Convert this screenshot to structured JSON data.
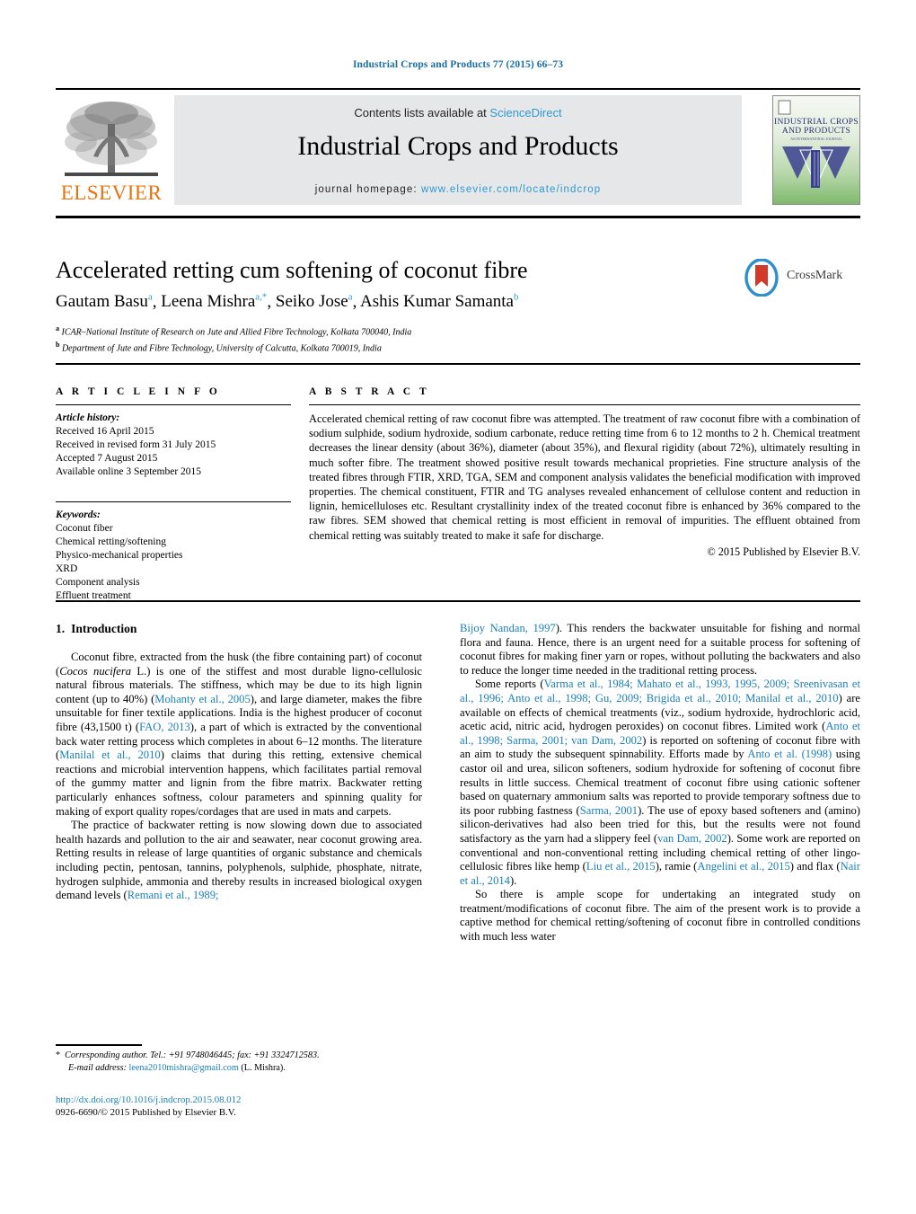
{
  "running_head": "Industrial Crops and Products 77 (2015) 66–73",
  "masthead": {
    "contents_prefix": "Contents lists available at ",
    "sciencedirect": "ScienceDirect",
    "journal_title": "Industrial Crops and Products",
    "homepage_prefix": "journal homepage: ",
    "homepage_url": "www.elsevier.com/locate/indcrop",
    "elsevier_wordmark": "ELSEVIER",
    "cover_title_line1": "INDUSTRIAL CROPS",
    "cover_title_line2": "AND PRODUCTS",
    "accent_color": "#2e9ad0",
    "elsevier_orange": "#E8730E"
  },
  "title_block": {
    "title": "Accelerated retting cum softening of coconut fibre",
    "authors": [
      {
        "name": "Gautam Basu",
        "marks": "a"
      },
      {
        "name": "Leena Mishra",
        "marks": "a,*"
      },
      {
        "name": "Seiko Jose",
        "marks": "a"
      },
      {
        "name": "Ashis Kumar Samanta",
        "marks": "b"
      }
    ],
    "affiliations": [
      {
        "mark": "a",
        "text": "ICAR–National Institute of Research on Jute and Allied Fibre Technology, Kolkata 700040, India"
      },
      {
        "mark": "b",
        "text": "Department of Jute and Fibre Technology, University of Calcutta, Kolkata 700019, India"
      }
    ],
    "crossmark_label": "CrossMark"
  },
  "article_info": {
    "heading": "A R T I C L E   I N F O",
    "history_label": "Article history:",
    "history": [
      "Received 16 April 2015",
      "Received in revised form 31 July 2015",
      "Accepted 7 August 2015",
      "Available online 3 September 2015"
    ],
    "keywords_label": "Keywords:",
    "keywords": [
      "Coconut fiber",
      "Chemical retting/softening",
      "Physico-mechanical properties",
      "XRD",
      "Component analysis",
      "Effluent treatment"
    ]
  },
  "abstract": {
    "heading": "A B S T R A C T",
    "text": "Accelerated chemical retting of raw coconut fibre was attempted. The treatment of raw coconut fibre with a combination of sodium sulphide, sodium hydroxide, sodium carbonate, reduce retting time from 6 to 12 months to 2 h. Chemical treatment decreases the linear density (about 36%), diameter (about 35%), and flexural rigidity (about 72%), ultimately resulting in much softer fibre. The treatment showed positive result towards mechanical proprieties. Fine structure analysis of the treated fibres through FTIR, XRD, TGA, SEM and component analysis validates the beneficial modification with improved properties. The chemical constituent, FTIR and TG analyses revealed enhancement of cellulose content and reduction in lignin, hemicelluloses etc. Resultant crystallinity index of the treated coconut fibre is enhanced by 36% compared to the raw fibres. SEM showed that chemical retting is most efficient in removal of impurities. The effluent obtained from chemical retting was suitably treated to make it safe for discharge.",
    "copyright": "© 2015 Published by Elsevier B.V."
  },
  "introduction": {
    "heading_number": "1.",
    "heading_text": "Introduction",
    "left_paragraphs": [
      "Coconut fibre, extracted from the husk (the fibre containing part) of coconut (Cocos nucifera L.) is one of the stiffest and most durable ligno-cellulosic natural fibrous materials. The stiffness, which may be due to its high lignin content (up to 40%) (Mohanty et al., 2005), and large diameter, makes the fibre unsuitable for finer textile applications. India is the highest producer of coconut fibre (43,1500 t) (FAO, 2013), a part of which is extracted by the conventional back water retting process which completes in about 6–12 months. The literature (Manilal et al., 2010) claims that during this retting, extensive chemical reactions and microbial intervention happens, which facilitates partial removal of the gummy matter and lignin from the fibre matrix. Backwater retting particularly enhances softness, colour parameters and spinning quality for making of export quality ropes/cordages that are used in mats and carpets.",
      "The practice of backwater retting is now slowing down due to associated health hazards and pollution to the air and seawater, near coconut growing area. Retting results in release of large quantities of organic substance and chemicals including pectin, pentosan, tannins, polyphenols, sulphide, phosphate, nitrate, hydrogen sulphide, ammonia and thereby results in increased biological oxygen demand levels (Remani et al., 1989;"
    ],
    "right_paragraphs": [
      "Bijoy Nandan, 1997). This renders the backwater unsuitable for fishing and normal flora and fauna. Hence, there is an urgent need for a suitable process for softening of coconut fibres for making finer yarn or ropes, without polluting the backwaters and also to reduce the longer time needed in the traditional retting process.",
      "Some reports (Varma et al., 1984; Mahato et al., 1993, 1995, 2009; Sreenivasan et al., 1996; Anto et al., 1998; Gu, 2009; Brigida et al., 2010; Manilal et al., 2010) are available on effects of chemical treatments (viz., sodium hydroxide, hydrochloric acid, acetic acid, nitric acid, hydrogen peroxides) on coconut fibres. Limited work (Anto et al., 1998; Sarma, 2001; van Dam, 2002) is reported on softening of coconut fibre with an aim to study the subsequent spinnability. Efforts made by Anto et al. (1998) using castor oil and urea, silicon softeners, sodium hydroxide for softening of coconut fibre results in little success. Chemical treatment of coconut fibre using cationic softener based on quaternary ammonium salts was reported to provide temporary softness due to its poor rubbing fastness (Sarma, 2001). The use of epoxy based softeners and (amino) silicon-derivatives had also been tried for this, but the results were not found satisfactory as the yarn had a slippery feel (van Dam, 2002). Some work are reported on conventional and non-conventional retting including chemical retting of other lingo-cellulosic fibres like hemp (Liu et al., 2015), ramie (Angelini et al., 2015) and flax (Nair et al., 2014).",
      "So there is ample scope for undertaking an integrated study on treatment/modifications of coconut fibre. The aim of the present work is to provide a captive method for chemical retting/softening of coconut fibre in controlled conditions with much less water"
    ]
  },
  "footnote": {
    "star": "*",
    "corresponding": "Corresponding author. Tel.: +91 9748046445; fax: +91 3324712583.",
    "email_label": "E-mail address:",
    "email": "leena2010mishra@gmail.com",
    "email_suffix": "(L. Mishra)."
  },
  "bottom": {
    "doi": "http://dx.doi.org/10.1016/j.indcrop.2015.08.012",
    "issn_line": "0926-6690/© 2015 Published by Elsevier B.V."
  }
}
